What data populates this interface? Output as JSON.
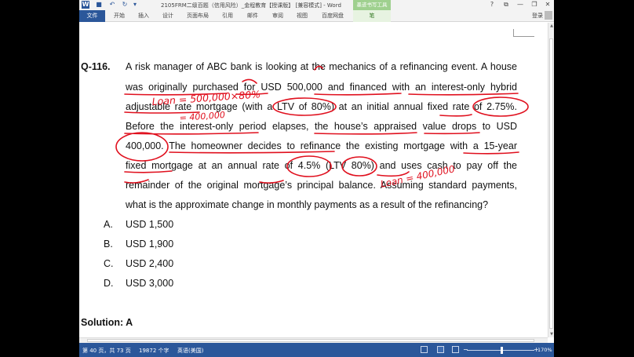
{
  "window": {
    "title": "2105FRM二级百题（信用风险）_金程教育【授课版】 [兼容模式] - Word",
    "ink_tools_tab": "墨迹书写工具",
    "help": "?",
    "restore": "⧉",
    "minimize": "—",
    "maximize": "❐",
    "close": "✕"
  },
  "ribbon": {
    "tabs": [
      "文件",
      "开始",
      "插入",
      "设计",
      "页面布局",
      "引用",
      "邮件",
      "审阅",
      "视图",
      "百度网盘"
    ],
    "pen_tab": "笔",
    "login": "登录"
  },
  "document": {
    "question_number": "Q-116.",
    "question_lines": [
      "A risk manager of ABC bank is looking at the mechanics of a refinancing event. A house",
      "was originally purchased for USD 500,000 and financed with an interest-only hybrid",
      "adjustable rate mortgage (with a LTV of 80%) at an initial annual fixed rate of 2.75%.",
      "Before the interest-only period elapses, the house’s appraised value drops to USD",
      "400,000. The homeowner decides to refinance the existing mortgage with a 15-year",
      "fixed mortgage at an annual rate of 4.5% (LTV 80%) and uses cash to pay off the",
      "remainder of the original mortgage’s principal balance. Assuming standard payments,",
      "what is the approximate change in monthly payments as a result of the refinancing?"
    ],
    "options": [
      {
        "letter": "A.",
        "text": "USD 1,500"
      },
      {
        "letter": "B.",
        "text": "USD 1,900"
      },
      {
        "letter": "C.",
        "text": "USD 2,400"
      },
      {
        "letter": "D.",
        "text": "USD 3,000"
      }
    ],
    "solution": "Solution: A",
    "annotations": {
      "loan_calc": "Loan = 500,000×80%",
      "loan_result": "= 400,000",
      "new_loan": "Loan = 400,000"
    },
    "ink_color": "#e0101e"
  },
  "statusbar": {
    "page": "第 40 页，共 73 页",
    "words": "19872 个字",
    "language": "英语(美国)",
    "zoom_minus": "−",
    "zoom_plus": "+",
    "zoom": "170%"
  },
  "colors": {
    "word_blue": "#2b579a",
    "ink_green": "#9fd08f"
  }
}
